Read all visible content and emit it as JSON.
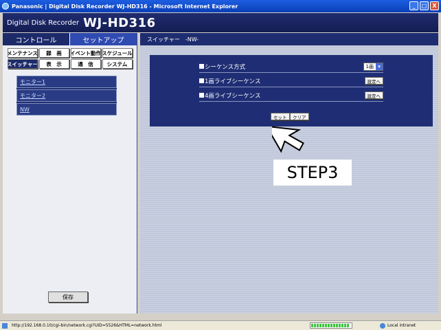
{
  "window": {
    "title": "Panasonic | Digital Disk Recorder WJ-HD316 - Microsoft Internet Explorer",
    "buttons": [
      "_",
      "□",
      "X"
    ]
  },
  "header": {
    "product_label": "Digital Disk Recorder",
    "model": "WJ-HD316"
  },
  "tabs": [
    {
      "label": "コントロール"
    },
    {
      "label": "セットアップ"
    }
  ],
  "menu": [
    {
      "label": "メンテナンス"
    },
    {
      "label": "録　画"
    },
    {
      "label": "イベント動作"
    },
    {
      "label": "スケジュール"
    },
    {
      "label": "スイッチャー"
    },
    {
      "label": "表　示"
    },
    {
      "label": "通　信"
    },
    {
      "label": "システム"
    }
  ],
  "submenu": [
    {
      "label": "モニター1"
    },
    {
      "label": "モニター2"
    },
    {
      "label": "NW"
    }
  ],
  "save_label": "保存",
  "page": {
    "title": "スイッチャー　-NW-",
    "rows": [
      {
        "label": "シーケンス方式",
        "value": "1画"
      },
      {
        "label": "1画ライブシーケンス",
        "button": "設定へ"
      },
      {
        "label": "4画ライブシーケンス",
        "button": "設定へ"
      }
    ],
    "set_label": "セット",
    "clear_label": "クリア"
  },
  "annotation": {
    "step": "STEP3"
  },
  "status": {
    "url": "http://192.168.0.10/cgi-bin/network.cgi?UID=5526&HTML=network.html",
    "zone": "Local intranet"
  }
}
